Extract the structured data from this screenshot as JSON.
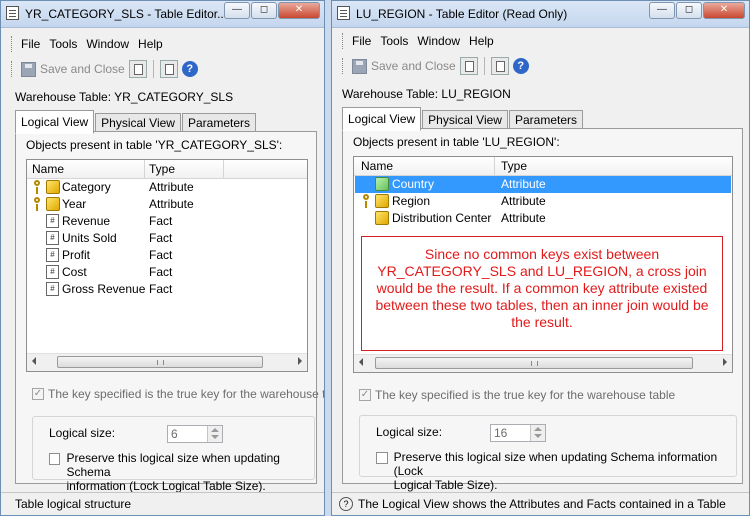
{
  "left": {
    "title": "YR_CATEGORY_SLS - Table Editor...",
    "menu": [
      "File",
      "Tools",
      "Window",
      "Help"
    ],
    "toolbar_save": "Save and Close",
    "warehouse_label": "Warehouse Table: YR_CATEGORY_SLS",
    "tabs": [
      "Logical View",
      "Physical View",
      "Parameters"
    ],
    "objects_label": "Objects present in table 'YR_CATEGORY_SLS':",
    "col_name": "Name",
    "col_type": "Type",
    "rows": [
      {
        "name": "Category",
        "type": "Attribute",
        "icon": "key-attribute-icon"
      },
      {
        "name": "Year",
        "type": "Attribute",
        "icon": "key-attribute-icon"
      },
      {
        "name": "Revenue",
        "type": "Fact",
        "icon": "fact-icon"
      },
      {
        "name": "Units Sold",
        "type": "Fact",
        "icon": "fact-icon"
      },
      {
        "name": "Profit",
        "type": "Fact",
        "icon": "fact-icon"
      },
      {
        "name": "Cost",
        "type": "Fact",
        "icon": "fact-icon"
      },
      {
        "name": "Gross Revenue",
        "type": "Fact",
        "icon": "fact-icon"
      }
    ],
    "truekey_text": "The key specified is the true key for the warehouse table",
    "logical_size_label": "Logical size:",
    "logical_size_value": "6",
    "preserve_text_1": "Preserve this logical size when updating Schema",
    "preserve_text_2": "information (Lock Logical Table Size).",
    "status": "Table logical structure"
  },
  "right": {
    "title": "LU_REGION - Table Editor (Read Only)",
    "menu": [
      "File",
      "Tools",
      "Window",
      "Help"
    ],
    "toolbar_save": "Save and Close",
    "warehouse_label": "Warehouse Table: LU_REGION",
    "tabs": [
      "Logical View",
      "Physical View",
      "Parameters"
    ],
    "objects_label": "Objects present in table 'LU_REGION':",
    "col_name": "Name",
    "col_type": "Type",
    "rows": [
      {
        "name": "Country",
        "type": "Attribute",
        "icon": "attribute-icon",
        "selected": true
      },
      {
        "name": "Region",
        "type": "Attribute",
        "icon": "key-attribute-icon"
      },
      {
        "name": "Distribution Center",
        "type": "Attribute",
        "icon": "attribute-icon"
      }
    ],
    "annotation": "Since no common keys exist between YR_CATEGORY_SLS and LU_REGION, a cross join would be the result.  If a common key attribute existed between these two tables, then an inner join would be the result.",
    "truekey_text": "The key specified is the true key for the warehouse table",
    "logical_size_label": "Logical size:",
    "logical_size_value": "16",
    "preserve_text_1": "Preserve this logical size when updating Schema information (Lock",
    "preserve_text_2": "Logical Table Size).",
    "status": "The Logical View shows the Attributes and Facts contained in a Table"
  },
  "colors": {
    "selection": "#3399ff",
    "annotation_text": "#e31a1a",
    "annotation_border": "#d42020"
  }
}
